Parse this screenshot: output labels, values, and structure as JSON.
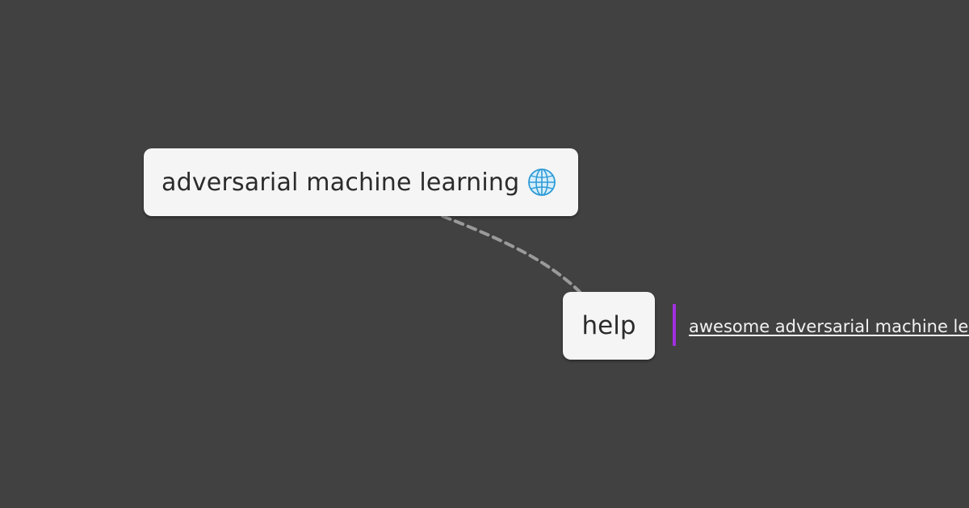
{
  "root": {
    "label": "adversarial machine learning",
    "icon": "globe-icon"
  },
  "child": {
    "label": "help"
  },
  "link": {
    "text": "awesome adversarial machine learning",
    "accent_color": "#a22fe0"
  },
  "colors": {
    "background": "#414141",
    "node_fill": "#f5f5f5",
    "edge": "#9a9a9a"
  }
}
